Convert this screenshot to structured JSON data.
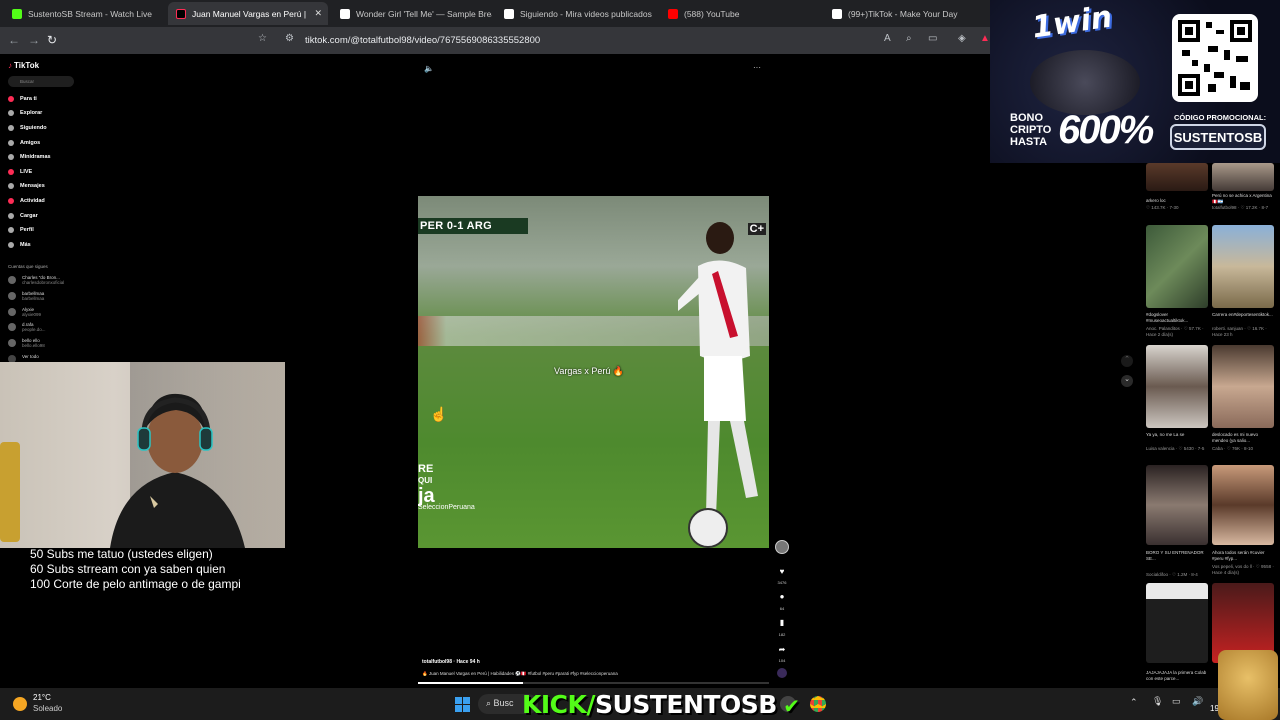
{
  "tabs": [
    {
      "label": "SustentoSB Stream - Watch Live",
      "active": false
    },
    {
      "label": "Juan Manuel Vargas en Perú |",
      "active": true
    },
    {
      "label": "Wonder Girl 'Tell Me' — Sample Brea",
      "active": false
    },
    {
      "label": "Siguiendo - Mira videos publicados",
      "active": false
    },
    {
      "label": "(588) YouTube",
      "active": false
    },
    {
      "label": "(99+)TikTok - Make Your Day",
      "active": false
    }
  ],
  "address": {
    "url": "tiktok.com/@totalfutbol98/video/7675569086335552800"
  },
  "sidebar": {
    "logo": "TikTok",
    "search_placeholder": "Buscar",
    "items": [
      "Para ti",
      "Explorar",
      "Siguiendo",
      "Amigos",
      "Minidramas",
      "LIVE",
      "Mensajes",
      "Actividad",
      "Cargar",
      "Perfil",
      "Más"
    ],
    "following_title": "Cuentas que sigues",
    "accounts": [
      {
        "name": "Charles \"do Bron...",
        "handle": "charlesdobronxoficial"
      },
      {
        "name": "barbellmaa",
        "handle": "barbellmaa"
      },
      {
        "name": "Alyxie",
        "handle": "alyxie099"
      },
      {
        "name": "d.rafa",
        "handle": "people.do..."
      },
      {
        "name": "bello ello",
        "handle": "bello.ello98"
      }
    ],
    "see_all": "Ver todo"
  },
  "video": {
    "score": "PER  0-1  ARG",
    "channel_badge": "C+",
    "caption": "Vargas x Perú 🔥",
    "watermark_top": "RE",
    "watermark_mid": "QUI",
    "watermark_big": "ja",
    "watermark_tag": "SeleccionPeruana",
    "more_label": "···",
    "mute_label": "🔈"
  },
  "actions": {
    "likes": "3476",
    "comments": "64",
    "saves": "182",
    "shares": "104"
  },
  "post": {
    "author": "totalfutbol98 · Hace 94 h",
    "description": "🔥 Juan Manuel Vargas en Perú | Habilidades ⚽🇵🇪 #futbol #peru #parati #fyp #seleccionperuana"
  },
  "feed": [
    {
      "title": "arkero loc",
      "meta": "♡ 143.7K · 7-30"
    },
    {
      "title": "Perú no se achica x Argentina 🇵🇪🇦🇷",
      "meta": "totalfutbol98 · ♡ 17.2K · 8-7"
    },
    {
      "title": "#dogslover #museoactualtiktok...",
      "meta": "Anoc. Palanditos · ♡ 57.7K · Hace 2 día(s)"
    },
    {
      "title": "Carrera en#deportesentiktok...",
      "meta": "roberti. sanjuan · ♡ 16.7K · Hace 23 h"
    },
    {
      "title": "Ya ya, no me La se",
      "meta": "Luisa valencia · ♡ 5430 · 7-5"
    },
    {
      "title": "deslocado es mi nuevo mendeo (ya salio...",
      "meta": "Caba · ♡ 76K · 8-10"
    },
    {
      "title": "BORO Y SU ENTRENADOR SE...",
      "meta": "Socialdifoo · ♡ 1.2M · 8-4"
    },
    {
      "title": "Ahora todos serán #cuvier #peru #fyp...",
      "meta": "Vos pepeli, vos do ll · ♡ 9558 · Hace 4 día(s)"
    },
    {
      "title": "JAJAJAJAJA la primera Colab con este parce...",
      "meta": ""
    },
    {
      "title": "",
      "meta": ""
    }
  ],
  "ad": {
    "brand": "1win",
    "bono_line1": "BONO",
    "bono_line2": "CRIPTO",
    "bono_line3": "HASTA",
    "percent": "600%",
    "promo_label": "CÓDIGO PROMOCIONAL:",
    "promo_code": "SUSTENTOSB"
  },
  "overlay": {
    "sub_goals": [
      "50 Subs me tatuo (ustedes eligen)",
      "60 Subs strream con ya saben quien",
      "100 Corte de pelo antimage o de gampi"
    ],
    "kick_brand": "KICK/",
    "kick_name": "SUSTENTOSB"
  },
  "taskbar": {
    "temperature": "21°C",
    "weather": "Soleado",
    "search_label": "Busc",
    "date": "19/0"
  },
  "colors": {
    "kick_green": "#53fc18",
    "tiktok_red": "#fe2c55"
  }
}
